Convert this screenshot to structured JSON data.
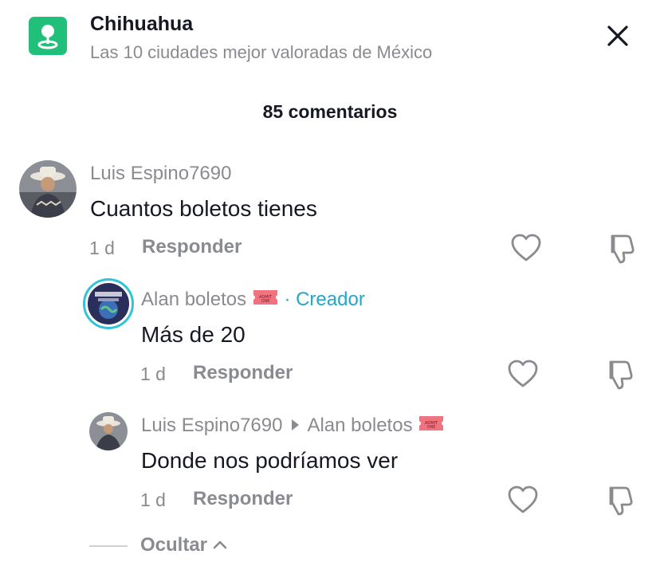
{
  "header": {
    "location_icon": "location-pin-icon",
    "title": "Chihuahua",
    "subtitle": "Las 10 ciudades mejor valoradas de México",
    "close_icon": "close-icon"
  },
  "comments_count": "85 comentarios",
  "comments": [
    {
      "username": "Luis Espino7690",
      "text": "Cuantos boletos tienes",
      "time": "1 d",
      "reply_label": "Responder"
    },
    {
      "username": "Alan boletos",
      "badge": "· Creador",
      "text": "Más de 20",
      "time": "1 d",
      "reply_label": "Responder"
    },
    {
      "username": "Luis Espino7690",
      "reply_to": "Alan boletos",
      "text": "Donde nos podríamos ver",
      "time": "1 d",
      "reply_label": "Responder"
    }
  ],
  "hide_label": "Ocultar",
  "colors": {
    "accent_green": "#20c07a",
    "creator_blue": "#20a8c8",
    "muted": "#8a8b91",
    "ticket_pink": "#f07480"
  }
}
